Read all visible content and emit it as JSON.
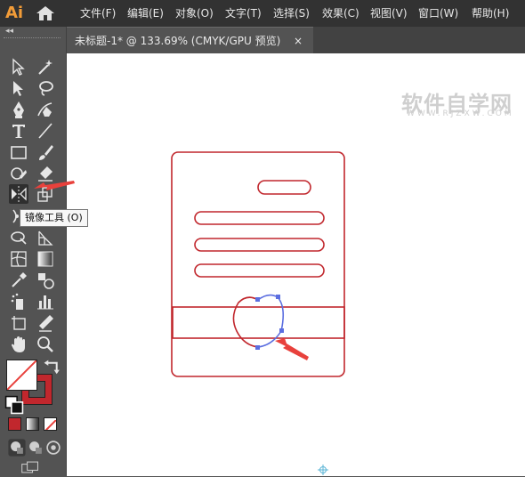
{
  "app": {
    "logo": "Ai"
  },
  "menu": {
    "items": [
      "文件(F)",
      "编辑(E)",
      "对象(O)",
      "文字(T)",
      "选择(S)",
      "效果(C)",
      "视图(V)",
      "窗口(W)",
      "帮助(H)"
    ]
  },
  "tab": {
    "title": "未标题-1* @ 133.69% (CMYK/GPU 预览)",
    "close": "×"
  },
  "toolbar": {
    "collapse": "◂◂",
    "tooltip": "镜像工具 (O)"
  },
  "watermark": {
    "main": "软件自学网",
    "sub": "WWW.RJZXW.COM"
  },
  "colors": {
    "stroke": "#c1272d",
    "selection": "#5b6ee0",
    "arrow": "#e8413c"
  }
}
